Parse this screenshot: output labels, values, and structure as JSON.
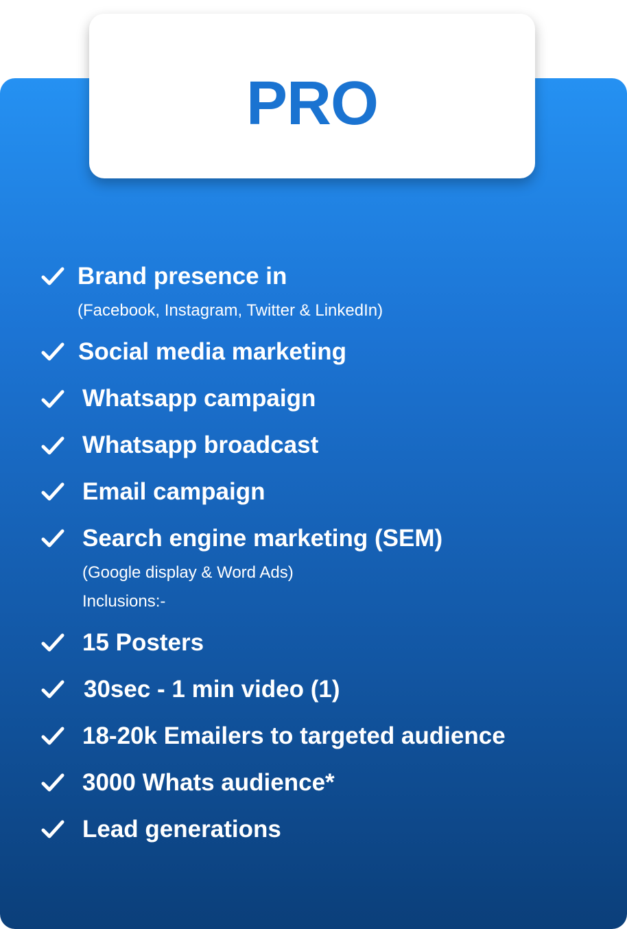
{
  "plan": {
    "title": "PRO"
  },
  "features": [
    {
      "label": "Brand presence in",
      "sub": "(Facebook, Instagram, Twitter & LinkedIn)"
    },
    {
      "label": "Social media marketing"
    },
    {
      "label": "Whatsapp campaign"
    },
    {
      "label": "Whatsapp broadcast"
    },
    {
      "label": "Email campaign"
    },
    {
      "label": "Search engine marketing (SEM)",
      "sub": "(Google display & Word Ads)",
      "sub2": "Inclusions:-"
    },
    {
      "label": "15 Posters"
    },
    {
      "label": "30sec - 1 min video (1)"
    },
    {
      "label": "18-20k Emailers to targeted audience"
    },
    {
      "label": "3000 Whats audience*"
    },
    {
      "label": "Lead generations"
    }
  ],
  "colors": {
    "accent": "#1a73d1",
    "card_top": "#2591f2",
    "card_bottom": "#0b3f7a",
    "text": "#ffffff"
  },
  "icons": {
    "feature_icon": "checkmark-icon"
  }
}
